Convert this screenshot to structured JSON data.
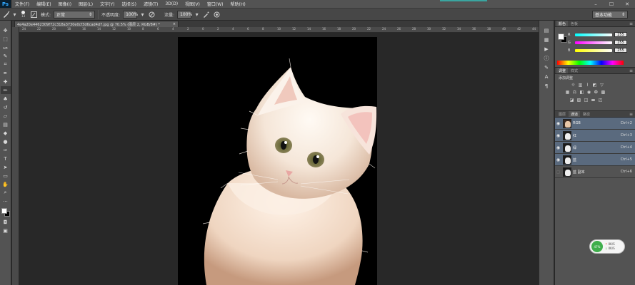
{
  "app": {
    "logo": "Ps"
  },
  "menu": {
    "items": [
      "文件(F)",
      "编辑(E)",
      "图像(I)",
      "图层(L)",
      "文字(Y)",
      "选择(S)",
      "滤镜(T)",
      "3D(D)",
      "视图(V)",
      "窗口(W)",
      "帮助(H)"
    ]
  },
  "window_controls": {
    "minimize": "–",
    "maximize": "☐",
    "close": "✕"
  },
  "options": {
    "brush_size": "13",
    "mode_label": "模式:",
    "mode_value": "正常",
    "opacity_label": "不透明度:",
    "opacity_value": "100%",
    "flow_label": "流量:",
    "flow_value": "100%",
    "workspace": "基本功能"
  },
  "document": {
    "tab_title": "4e4a20e4462309f72c318a3730e0cf3d6cad4d7.jpg @ 70.5% (图层 2, RGB/8#) *",
    "close": "×"
  },
  "ruler": {
    "ticks": [
      "24",
      "22",
      "20",
      "18",
      "16",
      "14",
      "12",
      "10",
      "8",
      "6",
      "4",
      "2",
      "0",
      "2",
      "4",
      "6",
      "8",
      "10",
      "12",
      "14",
      "16",
      "18",
      "20",
      "22",
      "24",
      "26",
      "28",
      "30",
      "32",
      "34",
      "36",
      "38",
      "40",
      "42",
      "44"
    ]
  },
  "color_panel": {
    "tabs": [
      "颜色",
      "色板"
    ],
    "channels": [
      {
        "label": "R",
        "value": "255"
      },
      {
        "label": "G",
        "value": "255"
      },
      {
        "label": "B",
        "value": "255"
      }
    ]
  },
  "adjustments_panel": {
    "tabs": [
      "调整",
      "样式"
    ],
    "title": "添加调整"
  },
  "channels_panel": {
    "tabs": [
      "图层",
      "通道",
      "路径"
    ],
    "rows": [
      {
        "name": "RGB",
        "shortcut": "Ctrl+2",
        "visible": true,
        "selected": true
      },
      {
        "name": "红",
        "shortcut": "Ctrl+3",
        "visible": true,
        "selected": true
      },
      {
        "name": "绿",
        "shortcut": "Ctrl+4",
        "visible": true,
        "selected": true
      },
      {
        "name": "蓝",
        "shortcut": "Ctrl+5",
        "visible": true,
        "selected": true
      },
      {
        "name": "蓝 副本",
        "shortcut": "Ctrl+6",
        "visible": false,
        "selected": false
      }
    ]
  },
  "speed_widget": {
    "percent": "47%",
    "up": "0K/S",
    "down": "0K/S"
  },
  "colors": {
    "accent_teal": "#3aa5a0",
    "selected_row": "#5a6a7e",
    "speed_green": "#3fae4c"
  }
}
